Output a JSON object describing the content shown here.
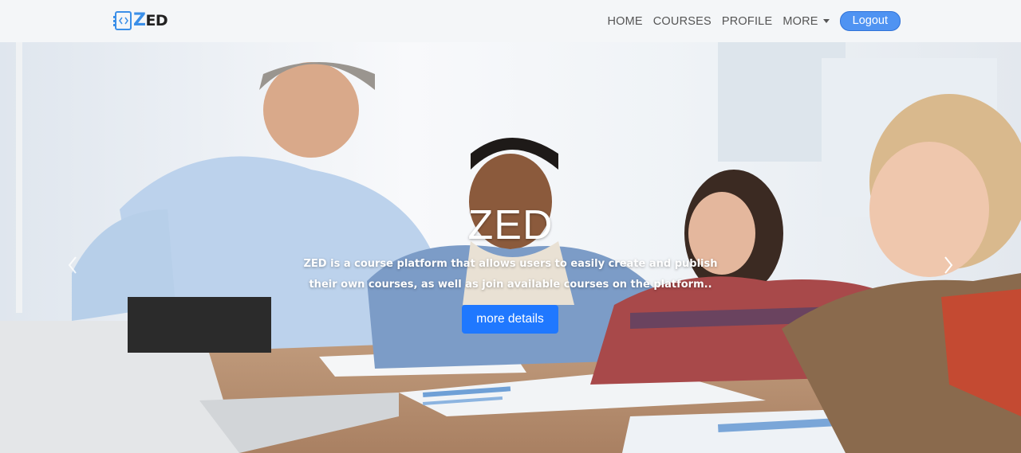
{
  "brand": {
    "z": "Z",
    "ed": "ED",
    "icon": "code-notebook-icon"
  },
  "nav": {
    "items": [
      {
        "label": "HOME"
      },
      {
        "label": "COURSES"
      },
      {
        "label": "PROFILE"
      },
      {
        "label": "MORE"
      }
    ],
    "logout_label": "Logout"
  },
  "hero": {
    "title": "ZED",
    "text": "ZED is a course platform that allows users to easily create and publish their own courses, as well as join available courses on the platform..",
    "button_label": "more details",
    "prev_icon": "chevron-left-icon",
    "next_icon": "chevron-right-icon"
  },
  "colors": {
    "accent": "#3b8fe8",
    "button": "#1f78ff",
    "logout": "#4f93f2",
    "navbar": "#f4f6f8"
  }
}
